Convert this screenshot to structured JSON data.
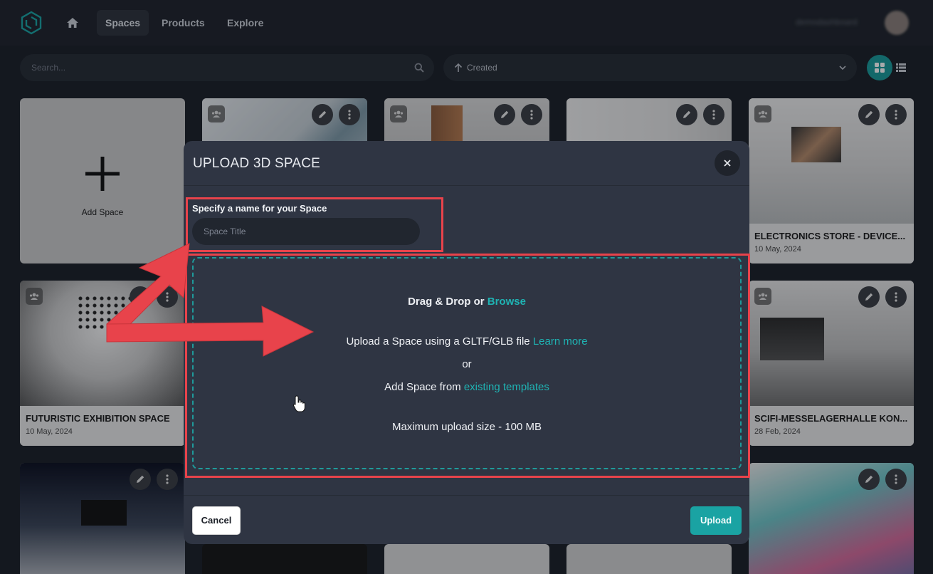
{
  "nav": {
    "tabs": [
      {
        "label": "Spaces",
        "active": true
      },
      {
        "label": "Products",
        "active": false
      },
      {
        "label": "Explore",
        "active": false
      }
    ],
    "username": "demodashboard",
    "icons": {
      "logo": "cube-logo-icon",
      "home": "home-icon",
      "avatar": "user-avatar"
    }
  },
  "toolbar": {
    "search_placeholder": "Search...",
    "sort_label": "Created",
    "view_modes": [
      "grid",
      "list"
    ],
    "active_view": "grid"
  },
  "add_card": {
    "label": "Add Space"
  },
  "spaces": [
    {
      "title": "ELECTRONICS STORE - DEVICE...",
      "date": "10 May, 2024"
    },
    {
      "title": "FUTURISTIC EXHIBITION SPACE",
      "date": "10 May, 2024"
    },
    {
      "title": "SCIFI-MESSELAGERHALLE KON...",
      "date": "28 Feb, 2024"
    }
  ],
  "modal": {
    "title": "UPLOAD 3D SPACE",
    "name_label": "Specify a name for your Space",
    "name_placeholder": "Space Title",
    "name_value": "",
    "dropzone": {
      "drag_text": "Drag & Drop or",
      "browse_link": "Browse",
      "upload_text": "Upload a Space using a GLTF/GLB file",
      "learn_more_link": "Learn more",
      "or_text": "or",
      "template_text": "Add Space from",
      "template_link": "existing templates",
      "max_size_text": "Maximum upload size - 100 MB"
    },
    "cancel_label": "Cancel",
    "upload_label": "Upload"
  },
  "colors": {
    "accent": "#1aa3a3",
    "background": "#1b1f27",
    "modal": "#2f3543",
    "annotation": "#e8434b"
  }
}
